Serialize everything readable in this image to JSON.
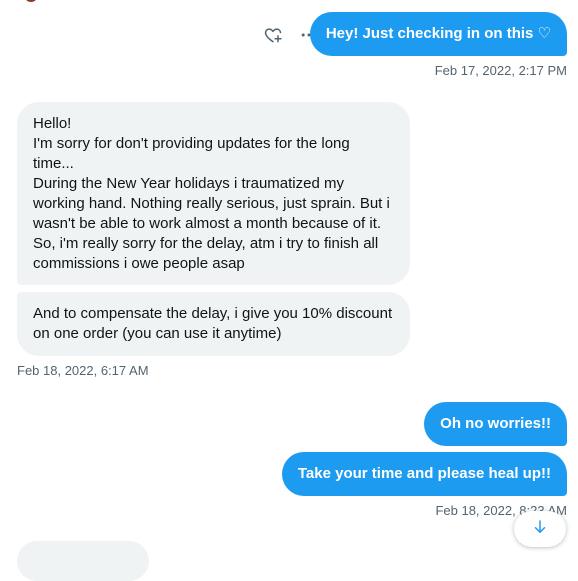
{
  "messages": {
    "m1": {
      "text": "Hey! Just checking in on this ♡",
      "timestamp": "Feb 17, 2022, 2:17 PM"
    },
    "m2": {
      "lines": [
        "Hello!",
        "I'm sorry for don't providing updates for the long time...",
        "During the New Year holidays i traumatized my working hand. Nothing really serious, just sprain. But i wasn't be able to work almost a month because of it.",
        "So, i'm really sorry for the delay, atm i try to finish all commissions i owe people asap"
      ]
    },
    "m3": {
      "text": "And to compensate the delay, i give you 10% discount on one order (you can use it anytime)",
      "timestamp": "Feb 18, 2022, 6:17 AM"
    },
    "m4": {
      "text": "Oh no worries!!"
    },
    "m5": {
      "text": "Take your time and please heal up!!",
      "timestamp": "Feb 18, 2022, 8:23 AM"
    }
  },
  "icons": {
    "react": "heart-plus-icon",
    "more": "more-icon",
    "scroll": "arrow-down-icon"
  },
  "colors": {
    "accent": "#1d9bf0",
    "incoming_bg": "#eff3f4",
    "muted_text": "#536471"
  }
}
